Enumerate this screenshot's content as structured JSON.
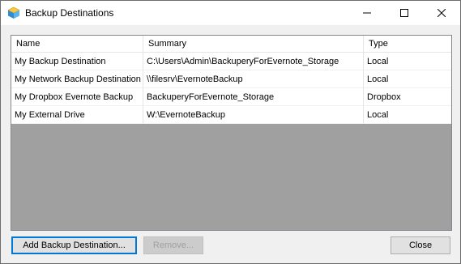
{
  "window": {
    "title": "Backup Destinations"
  },
  "titlebar": {
    "app_icon": "backup-app-icon",
    "minimize_icon": "minimize-icon",
    "maximize_icon": "maximize-icon",
    "close_icon": "close-icon"
  },
  "list": {
    "columns": [
      "Name",
      "Summary",
      "Type"
    ],
    "rows": [
      {
        "name": "My Backup Destination",
        "summary": "C:\\Users\\Admin\\BackuperyForEvernote_Storage",
        "type": "Local"
      },
      {
        "name": "My Network Backup Destination",
        "summary": "\\\\filesrv\\EvernoteBackup",
        "type": "Local"
      },
      {
        "name": "My Dropbox Evernote Backup",
        "summary": "BackuperyForEvernote_Storage",
        "type": "Dropbox"
      },
      {
        "name": "My External Drive",
        "summary": "W:\\EvernoteBackup",
        "type": "Local"
      }
    ]
  },
  "buttons": {
    "add_label": "Add Backup Destination...",
    "remove_label": "Remove...",
    "close_label": "Close"
  },
  "colors": {
    "listview_empty_bg": "#a0a0a0",
    "window_bg": "#f0f0f0",
    "focus_border": "#0078d7"
  }
}
